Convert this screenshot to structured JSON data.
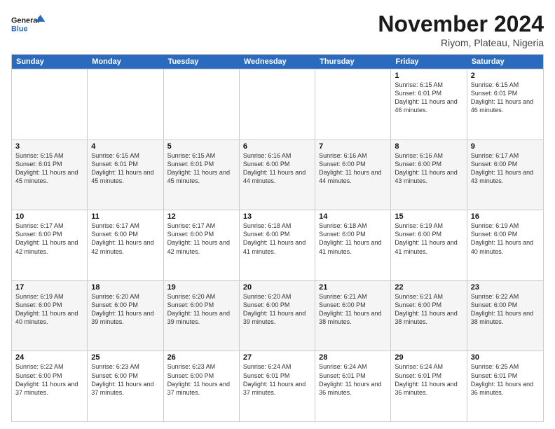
{
  "logo": {
    "line1": "General",
    "line2": "Blue"
  },
  "header": {
    "month": "November 2024",
    "location": "Riyom, Plateau, Nigeria"
  },
  "days": [
    "Sunday",
    "Monday",
    "Tuesday",
    "Wednesday",
    "Thursday",
    "Friday",
    "Saturday"
  ],
  "rows": [
    [
      {
        "day": "",
        "text": ""
      },
      {
        "day": "",
        "text": ""
      },
      {
        "day": "",
        "text": ""
      },
      {
        "day": "",
        "text": ""
      },
      {
        "day": "",
        "text": ""
      },
      {
        "day": "1",
        "text": "Sunrise: 6:15 AM\nSunset: 6:01 PM\nDaylight: 11 hours and 46 minutes."
      },
      {
        "day": "2",
        "text": "Sunrise: 6:15 AM\nSunset: 6:01 PM\nDaylight: 11 hours and 46 minutes."
      }
    ],
    [
      {
        "day": "3",
        "text": "Sunrise: 6:15 AM\nSunset: 6:01 PM\nDaylight: 11 hours and 45 minutes."
      },
      {
        "day": "4",
        "text": "Sunrise: 6:15 AM\nSunset: 6:01 PM\nDaylight: 11 hours and 45 minutes."
      },
      {
        "day": "5",
        "text": "Sunrise: 6:15 AM\nSunset: 6:01 PM\nDaylight: 11 hours and 45 minutes."
      },
      {
        "day": "6",
        "text": "Sunrise: 6:16 AM\nSunset: 6:00 PM\nDaylight: 11 hours and 44 minutes."
      },
      {
        "day": "7",
        "text": "Sunrise: 6:16 AM\nSunset: 6:00 PM\nDaylight: 11 hours and 44 minutes."
      },
      {
        "day": "8",
        "text": "Sunrise: 6:16 AM\nSunset: 6:00 PM\nDaylight: 11 hours and 43 minutes."
      },
      {
        "day": "9",
        "text": "Sunrise: 6:17 AM\nSunset: 6:00 PM\nDaylight: 11 hours and 43 minutes."
      }
    ],
    [
      {
        "day": "10",
        "text": "Sunrise: 6:17 AM\nSunset: 6:00 PM\nDaylight: 11 hours and 42 minutes."
      },
      {
        "day": "11",
        "text": "Sunrise: 6:17 AM\nSunset: 6:00 PM\nDaylight: 11 hours and 42 minutes."
      },
      {
        "day": "12",
        "text": "Sunrise: 6:17 AM\nSunset: 6:00 PM\nDaylight: 11 hours and 42 minutes."
      },
      {
        "day": "13",
        "text": "Sunrise: 6:18 AM\nSunset: 6:00 PM\nDaylight: 11 hours and 41 minutes."
      },
      {
        "day": "14",
        "text": "Sunrise: 6:18 AM\nSunset: 6:00 PM\nDaylight: 11 hours and 41 minutes."
      },
      {
        "day": "15",
        "text": "Sunrise: 6:19 AM\nSunset: 6:00 PM\nDaylight: 11 hours and 41 minutes."
      },
      {
        "day": "16",
        "text": "Sunrise: 6:19 AM\nSunset: 6:00 PM\nDaylight: 11 hours and 40 minutes."
      }
    ],
    [
      {
        "day": "17",
        "text": "Sunrise: 6:19 AM\nSunset: 6:00 PM\nDaylight: 11 hours and 40 minutes."
      },
      {
        "day": "18",
        "text": "Sunrise: 6:20 AM\nSunset: 6:00 PM\nDaylight: 11 hours and 39 minutes."
      },
      {
        "day": "19",
        "text": "Sunrise: 6:20 AM\nSunset: 6:00 PM\nDaylight: 11 hours and 39 minutes."
      },
      {
        "day": "20",
        "text": "Sunrise: 6:20 AM\nSunset: 6:00 PM\nDaylight: 11 hours and 39 minutes."
      },
      {
        "day": "21",
        "text": "Sunrise: 6:21 AM\nSunset: 6:00 PM\nDaylight: 11 hours and 38 minutes."
      },
      {
        "day": "22",
        "text": "Sunrise: 6:21 AM\nSunset: 6:00 PM\nDaylight: 11 hours and 38 minutes."
      },
      {
        "day": "23",
        "text": "Sunrise: 6:22 AM\nSunset: 6:00 PM\nDaylight: 11 hours and 38 minutes."
      }
    ],
    [
      {
        "day": "24",
        "text": "Sunrise: 6:22 AM\nSunset: 6:00 PM\nDaylight: 11 hours and 37 minutes."
      },
      {
        "day": "25",
        "text": "Sunrise: 6:23 AM\nSunset: 6:00 PM\nDaylight: 11 hours and 37 minutes."
      },
      {
        "day": "26",
        "text": "Sunrise: 6:23 AM\nSunset: 6:00 PM\nDaylight: 11 hours and 37 minutes."
      },
      {
        "day": "27",
        "text": "Sunrise: 6:24 AM\nSunset: 6:01 PM\nDaylight: 11 hours and 37 minutes."
      },
      {
        "day": "28",
        "text": "Sunrise: 6:24 AM\nSunset: 6:01 PM\nDaylight: 11 hours and 36 minutes."
      },
      {
        "day": "29",
        "text": "Sunrise: 6:24 AM\nSunset: 6:01 PM\nDaylight: 11 hours and 36 minutes."
      },
      {
        "day": "30",
        "text": "Sunrise: 6:25 AM\nSunset: 6:01 PM\nDaylight: 11 hours and 36 minutes."
      }
    ]
  ]
}
